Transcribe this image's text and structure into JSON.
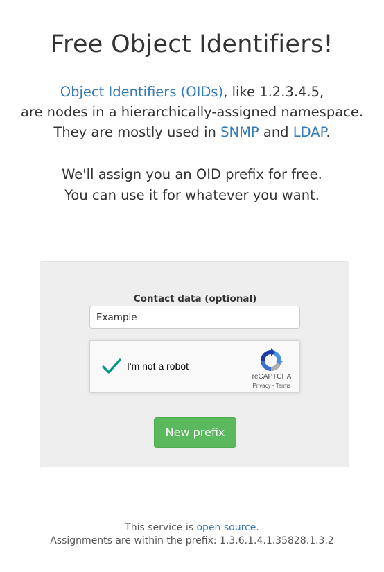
{
  "page": {
    "title": "Free Object Identifiers!"
  },
  "intro": {
    "oid_link": "Object Identifiers (OIDs)",
    "line1_suffix": ", like 1.2.3.4.5,",
    "line2": "are nodes in a hierarchically-assigned namespace.",
    "line3_prefix": "They are mostly used in ",
    "snmp_link": "SNMP",
    "line3_and": " and ",
    "ldap_link": "LDAP",
    "line3_suffix": "."
  },
  "offer": {
    "line1": "We'll assign you an OID prefix for free.",
    "line2": "You can use it for whatever you want."
  },
  "form": {
    "contact_label": "Contact data (optional)",
    "contact_value": "Example",
    "submit_label": "New prefix"
  },
  "captcha": {
    "checkbox_text": "I'm not a robot",
    "brand": "reCAPTCHA",
    "privacy_link": "Privacy",
    "separator": " - ",
    "terms_link": "Terms",
    "checked": true,
    "check_color": "#009688"
  },
  "footer": {
    "line1_prefix": "This service is ",
    "source_link": "open source",
    "line1_suffix": ".",
    "line2": "Assignments are within the prefix: 1.3.6.1.4.1.35828.1.3.2"
  },
  "colors": {
    "link": "#337ab7",
    "button": "#5cb85c",
    "panel": "#eeeeee"
  }
}
